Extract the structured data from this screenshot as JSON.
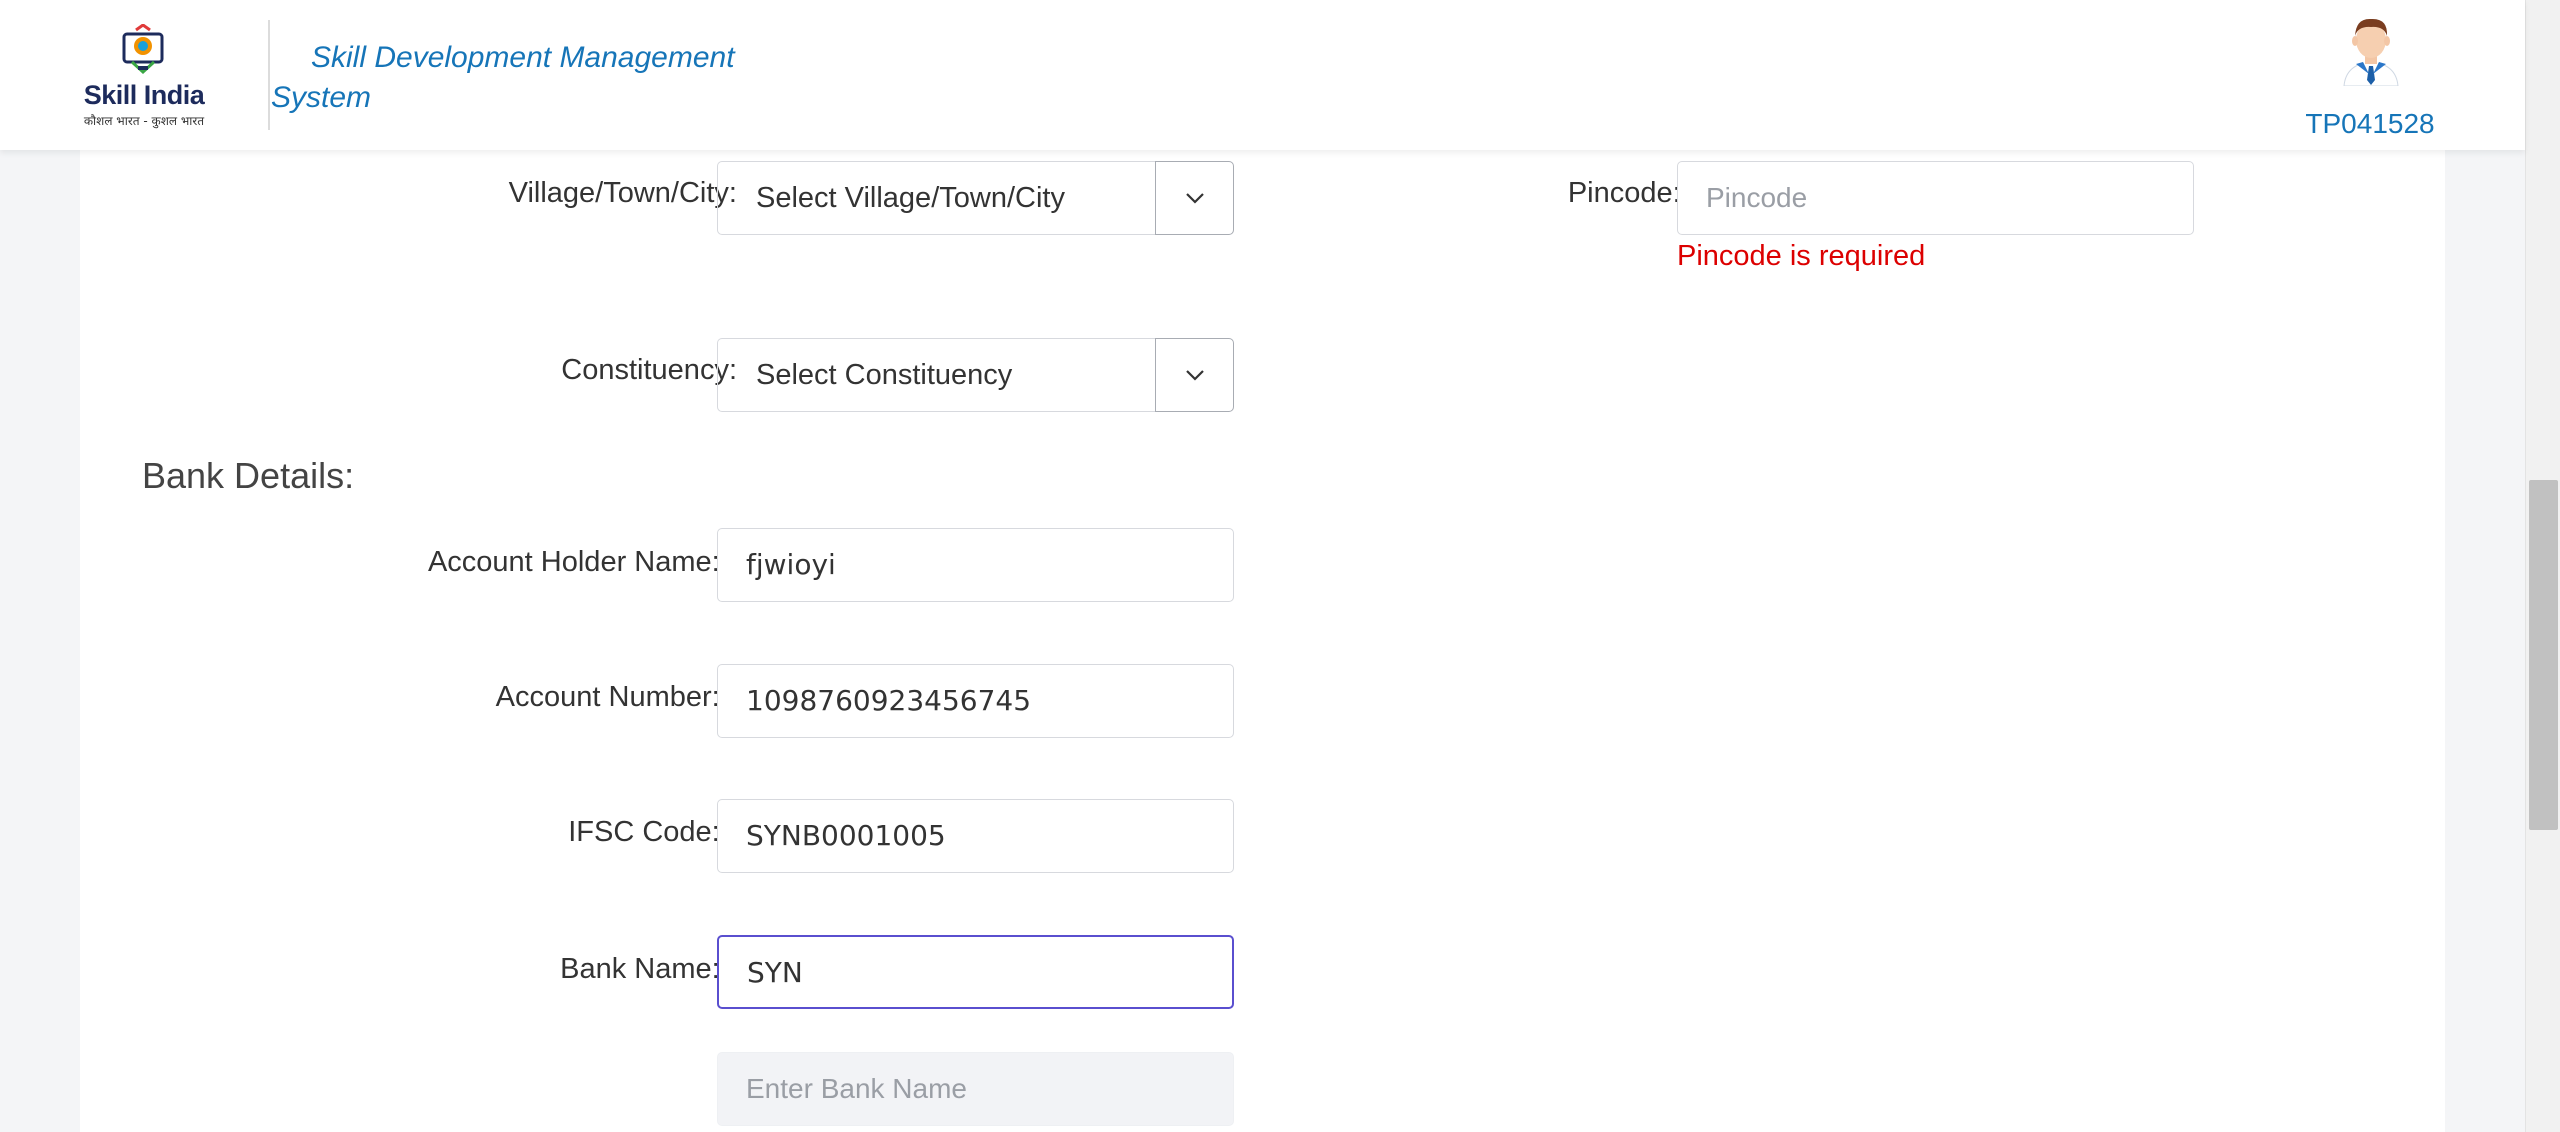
{
  "header": {
    "logo_word": "Skill India",
    "logo_tagline": "कौशल भारत - कुशल भारत",
    "app_title": "Skill Development Management System",
    "user_id": "TP041528"
  },
  "form": {
    "village": {
      "label": "Village/Town/City:",
      "value": "Select Village/Town/City"
    },
    "pincode": {
      "label": "Pincode:",
      "required": "*",
      "placeholder": "Pincode",
      "error": "Pincode is required"
    },
    "constituency": {
      "label": "Constituency:",
      "value": "Select Constituency"
    },
    "bank_section_title": "Bank Details:",
    "account_holder": {
      "label": "Account Holder Name:",
      "required": "*",
      "value": "fjwioyi"
    },
    "account_number": {
      "label": "Account Number:",
      "required": "*",
      "value": "1098760923456745"
    },
    "ifsc": {
      "label": "IFSC Code:",
      "required": "*",
      "value": "SYNB0001005"
    },
    "bank_name": {
      "label": "Bank Name:",
      "required": "*",
      "value": "SYN"
    },
    "bank_name_other": {
      "placeholder": "Enter Bank Name"
    }
  },
  "icons": {
    "dropdown": "chevron-down-icon",
    "avatar": "user-avatar-icon",
    "logo": "skill-india-logo"
  },
  "colors": {
    "brand_blue": "#1675b8",
    "error_red": "#dc0000",
    "focus_border": "#5a4fcf"
  }
}
